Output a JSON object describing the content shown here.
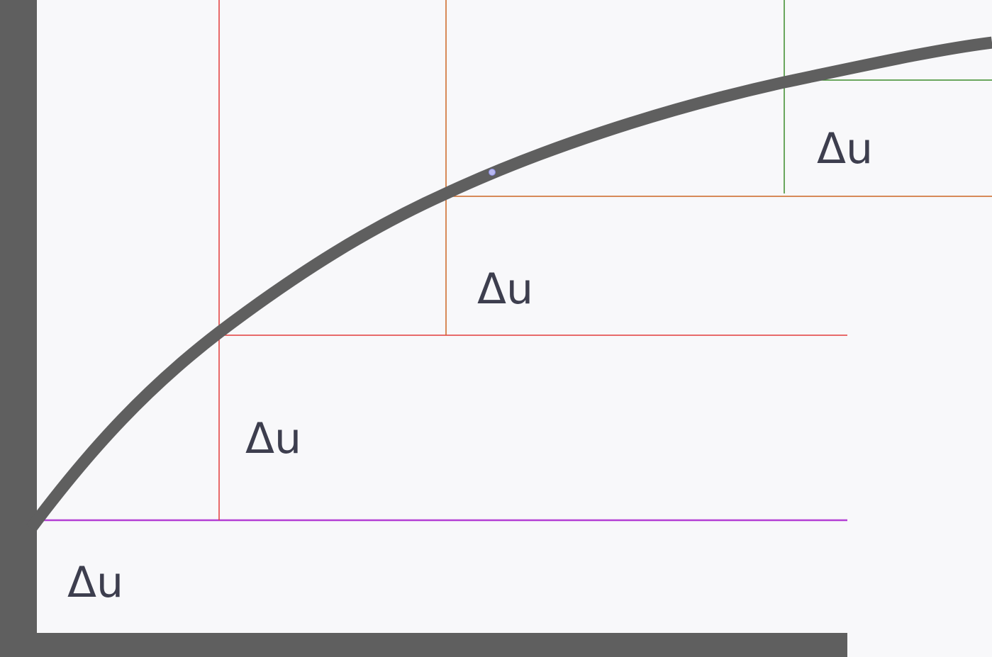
{
  "diagram": {
    "labels": [
      {
        "id": "delta-u-1",
        "text": "Δu"
      },
      {
        "id": "delta-u-2",
        "text": "Δu"
      },
      {
        "id": "delta-u-3",
        "text": "Δu"
      },
      {
        "id": "delta-u-4",
        "text": "Δu"
      }
    ],
    "colors": {
      "background": "#f8f8fa",
      "axis": "#5f5f5f",
      "curve": "#5f5f5f",
      "level_line_base": "#b43fd4",
      "level_line_1": "#e23a3a",
      "level_line_2": "#cc6622",
      "level_line_3": "#3a8a2a",
      "handle": "#b8b8f0",
      "label_text": "#3d3e4e"
    }
  }
}
